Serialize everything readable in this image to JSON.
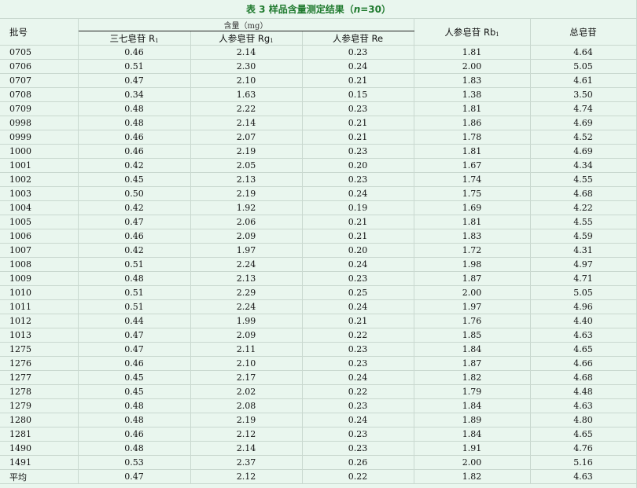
{
  "table": {
    "title_prefix": "表 3 样品含量测定结果（",
    "title_n": "n",
    "title_suffix": "=30）",
    "headers": {
      "batch": "批号",
      "group": "含量（mg）",
      "r1_zh": "三七皂苷 R",
      "r1_sub": "1",
      "rg1_zh": "人参皂苷 Rg",
      "rg1_sub": "1",
      "re": "人参皂苷 Re",
      "rb1_zh": "人参皂苷 Rb",
      "rb1_sub": "1",
      "total": "总皂苷"
    },
    "rows": [
      {
        "batch": "0705",
        "r1": "0.46",
        "rg1": "2.14",
        "re": "0.23",
        "rb1": "1.81",
        "total": "4.64"
      },
      {
        "batch": "0706",
        "r1": "0.51",
        "rg1": "2.30",
        "re": "0.24",
        "rb1": "2.00",
        "total": "5.05"
      },
      {
        "batch": "0707",
        "r1": "0.47",
        "rg1": "2.10",
        "re": "0.21",
        "rb1": "1.83",
        "total": "4.61"
      },
      {
        "batch": "0708",
        "r1": "0.34",
        "rg1": "1.63",
        "re": "0.15",
        "rb1": "1.38",
        "total": "3.50"
      },
      {
        "batch": "0709",
        "r1": "0.48",
        "rg1": "2.22",
        "re": "0.23",
        "rb1": "1.81",
        "total": "4.74"
      },
      {
        "batch": "0998",
        "r1": "0.48",
        "rg1": "2.14",
        "re": "0.21",
        "rb1": "1.86",
        "total": "4.69"
      },
      {
        "batch": "0999",
        "r1": "0.46",
        "rg1": "2.07",
        "re": "0.21",
        "rb1": "1.78",
        "total": "4.52"
      },
      {
        "batch": "1000",
        "r1": "0.46",
        "rg1": "2.19",
        "re": "0.23",
        "rb1": "1.81",
        "total": "4.69"
      },
      {
        "batch": "1001",
        "r1": "0.42",
        "rg1": "2.05",
        "re": "0.20",
        "rb1": "1.67",
        "total": "4.34"
      },
      {
        "batch": "1002",
        "r1": "0.45",
        "rg1": "2.13",
        "re": "0.23",
        "rb1": "1.74",
        "total": "4.55"
      },
      {
        "batch": "1003",
        "r1": "0.50",
        "rg1": "2.19",
        "re": "0.24",
        "rb1": "1.75",
        "total": "4.68"
      },
      {
        "batch": "1004",
        "r1": "0.42",
        "rg1": "1.92",
        "re": "0.19",
        "rb1": "1.69",
        "total": "4.22"
      },
      {
        "batch": "1005",
        "r1": "0.47",
        "rg1": "2.06",
        "re": "0.21",
        "rb1": "1.81",
        "total": "4.55"
      },
      {
        "batch": "1006",
        "r1": "0.46",
        "rg1": "2.09",
        "re": "0.21",
        "rb1": "1.83",
        "total": "4.59"
      },
      {
        "batch": "1007",
        "r1": "0.42",
        "rg1": "1.97",
        "re": "0.20",
        "rb1": "1.72",
        "total": "4.31"
      },
      {
        "batch": "1008",
        "r1": "0.51",
        "rg1": "2.24",
        "re": "0.24",
        "rb1": "1.98",
        "total": "4.97"
      },
      {
        "batch": "1009",
        "r1": "0.48",
        "rg1": "2.13",
        "re": "0.23",
        "rb1": "1.87",
        "total": "4.71"
      },
      {
        "batch": "1010",
        "r1": "0.51",
        "rg1": "2.29",
        "re": "0.25",
        "rb1": "2.00",
        "total": "5.05"
      },
      {
        "batch": "1011",
        "r1": "0.51",
        "rg1": "2.24",
        "re": "0.24",
        "rb1": "1.97",
        "total": "4.96"
      },
      {
        "batch": "1012",
        "r1": "0.44",
        "rg1": "1.99",
        "re": "0.21",
        "rb1": "1.76",
        "total": "4.40"
      },
      {
        "batch": "1013",
        "r1": "0.47",
        "rg1": "2.09",
        "re": "0.22",
        "rb1": "1.85",
        "total": "4.63"
      },
      {
        "batch": "1275",
        "r1": "0.47",
        "rg1": "2.11",
        "re": "0.23",
        "rb1": "1.84",
        "total": "4.65"
      },
      {
        "batch": "1276",
        "r1": "0.46",
        "rg1": "2.10",
        "re": "0.23",
        "rb1": "1.87",
        "total": "4.66"
      },
      {
        "batch": "1277",
        "r1": "0.45",
        "rg1": "2.17",
        "re": "0.24",
        "rb1": "1.82",
        "total": "4.68"
      },
      {
        "batch": "1278",
        "r1": "0.45",
        "rg1": "2.02",
        "re": "0.22",
        "rb1": "1.79",
        "total": "4.48"
      },
      {
        "batch": "1279",
        "r1": "0.48",
        "rg1": "2.08",
        "re": "0.23",
        "rb1": "1.84",
        "total": "4.63"
      },
      {
        "batch": "1280",
        "r1": "0.48",
        "rg1": "2.19",
        "re": "0.24",
        "rb1": "1.89",
        "total": "4.80"
      },
      {
        "batch": "1281",
        "r1": "0.46",
        "rg1": "2.12",
        "re": "0.23",
        "rb1": "1.84",
        "total": "4.65"
      },
      {
        "batch": "1490",
        "r1": "0.48",
        "rg1": "2.14",
        "re": "0.23",
        "rb1": "1.91",
        "total": "4.76"
      },
      {
        "batch": "1491",
        "r1": "0.53",
        "rg1": "2.37",
        "re": "0.26",
        "rb1": "2.00",
        "total": "5.16"
      },
      {
        "batch": "平均",
        "r1": "0.47",
        "rg1": "2.12",
        "re": "0.22",
        "rb1": "1.82",
        "total": "4.63"
      }
    ]
  },
  "colors": {
    "title": "#1f7a2e",
    "background": "#e9f6ee",
    "grid": "#c9d8cf"
  }
}
